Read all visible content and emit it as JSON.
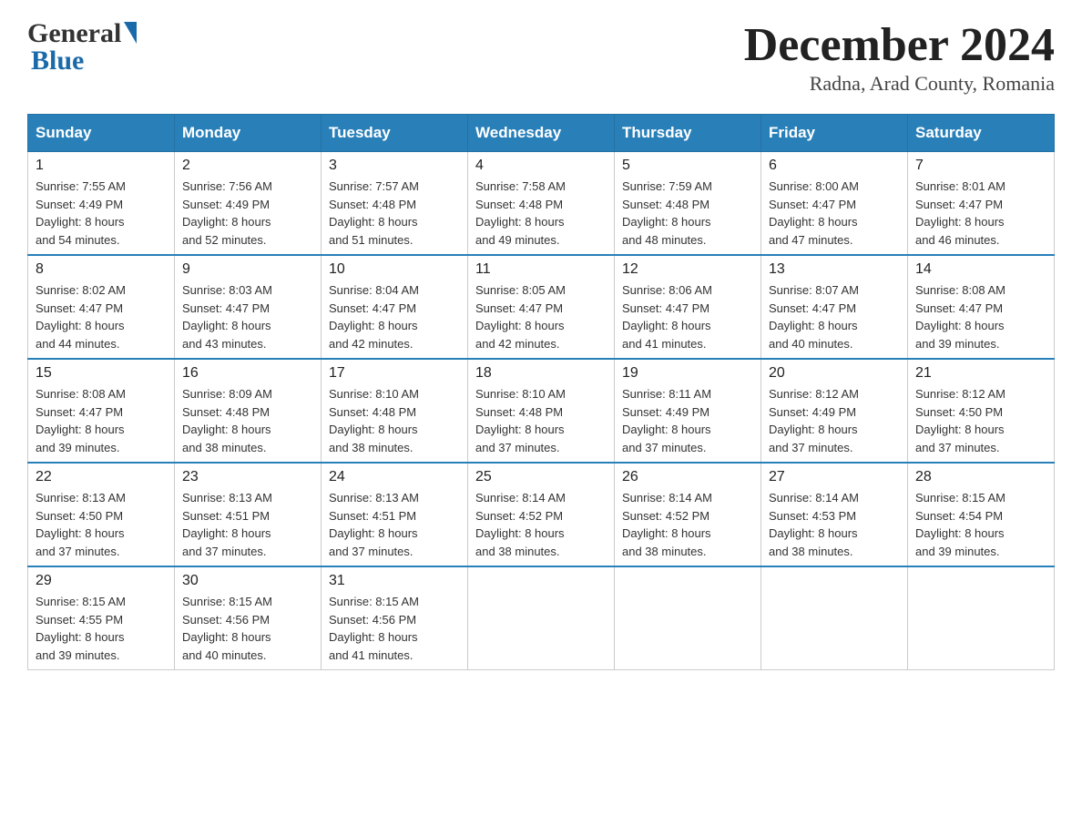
{
  "header": {
    "logo_general": "General",
    "logo_blue": "Blue",
    "month_title": "December 2024",
    "location": "Radna, Arad County, Romania"
  },
  "weekdays": [
    "Sunday",
    "Monday",
    "Tuesday",
    "Wednesday",
    "Thursday",
    "Friday",
    "Saturday"
  ],
  "weeks": [
    [
      {
        "day": "1",
        "sunrise": "Sunrise: 7:55 AM",
        "sunset": "Sunset: 4:49 PM",
        "daylight": "Daylight: 8 hours",
        "daylight2": "and 54 minutes."
      },
      {
        "day": "2",
        "sunrise": "Sunrise: 7:56 AM",
        "sunset": "Sunset: 4:49 PM",
        "daylight": "Daylight: 8 hours",
        "daylight2": "and 52 minutes."
      },
      {
        "day": "3",
        "sunrise": "Sunrise: 7:57 AM",
        "sunset": "Sunset: 4:48 PM",
        "daylight": "Daylight: 8 hours",
        "daylight2": "and 51 minutes."
      },
      {
        "day": "4",
        "sunrise": "Sunrise: 7:58 AM",
        "sunset": "Sunset: 4:48 PM",
        "daylight": "Daylight: 8 hours",
        "daylight2": "and 49 minutes."
      },
      {
        "day": "5",
        "sunrise": "Sunrise: 7:59 AM",
        "sunset": "Sunset: 4:48 PM",
        "daylight": "Daylight: 8 hours",
        "daylight2": "and 48 minutes."
      },
      {
        "day": "6",
        "sunrise": "Sunrise: 8:00 AM",
        "sunset": "Sunset: 4:47 PM",
        "daylight": "Daylight: 8 hours",
        "daylight2": "and 47 minutes."
      },
      {
        "day": "7",
        "sunrise": "Sunrise: 8:01 AM",
        "sunset": "Sunset: 4:47 PM",
        "daylight": "Daylight: 8 hours",
        "daylight2": "and 46 minutes."
      }
    ],
    [
      {
        "day": "8",
        "sunrise": "Sunrise: 8:02 AM",
        "sunset": "Sunset: 4:47 PM",
        "daylight": "Daylight: 8 hours",
        "daylight2": "and 44 minutes."
      },
      {
        "day": "9",
        "sunrise": "Sunrise: 8:03 AM",
        "sunset": "Sunset: 4:47 PM",
        "daylight": "Daylight: 8 hours",
        "daylight2": "and 43 minutes."
      },
      {
        "day": "10",
        "sunrise": "Sunrise: 8:04 AM",
        "sunset": "Sunset: 4:47 PM",
        "daylight": "Daylight: 8 hours",
        "daylight2": "and 42 minutes."
      },
      {
        "day": "11",
        "sunrise": "Sunrise: 8:05 AM",
        "sunset": "Sunset: 4:47 PM",
        "daylight": "Daylight: 8 hours",
        "daylight2": "and 42 minutes."
      },
      {
        "day": "12",
        "sunrise": "Sunrise: 8:06 AM",
        "sunset": "Sunset: 4:47 PM",
        "daylight": "Daylight: 8 hours",
        "daylight2": "and 41 minutes."
      },
      {
        "day": "13",
        "sunrise": "Sunrise: 8:07 AM",
        "sunset": "Sunset: 4:47 PM",
        "daylight": "Daylight: 8 hours",
        "daylight2": "and 40 minutes."
      },
      {
        "day": "14",
        "sunrise": "Sunrise: 8:08 AM",
        "sunset": "Sunset: 4:47 PM",
        "daylight": "Daylight: 8 hours",
        "daylight2": "and 39 minutes."
      }
    ],
    [
      {
        "day": "15",
        "sunrise": "Sunrise: 8:08 AM",
        "sunset": "Sunset: 4:47 PM",
        "daylight": "Daylight: 8 hours",
        "daylight2": "and 39 minutes."
      },
      {
        "day": "16",
        "sunrise": "Sunrise: 8:09 AM",
        "sunset": "Sunset: 4:48 PM",
        "daylight": "Daylight: 8 hours",
        "daylight2": "and 38 minutes."
      },
      {
        "day": "17",
        "sunrise": "Sunrise: 8:10 AM",
        "sunset": "Sunset: 4:48 PM",
        "daylight": "Daylight: 8 hours",
        "daylight2": "and 38 minutes."
      },
      {
        "day": "18",
        "sunrise": "Sunrise: 8:10 AM",
        "sunset": "Sunset: 4:48 PM",
        "daylight": "Daylight: 8 hours",
        "daylight2": "and 37 minutes."
      },
      {
        "day": "19",
        "sunrise": "Sunrise: 8:11 AM",
        "sunset": "Sunset: 4:49 PM",
        "daylight": "Daylight: 8 hours",
        "daylight2": "and 37 minutes."
      },
      {
        "day": "20",
        "sunrise": "Sunrise: 8:12 AM",
        "sunset": "Sunset: 4:49 PM",
        "daylight": "Daylight: 8 hours",
        "daylight2": "and 37 minutes."
      },
      {
        "day": "21",
        "sunrise": "Sunrise: 8:12 AM",
        "sunset": "Sunset: 4:50 PM",
        "daylight": "Daylight: 8 hours",
        "daylight2": "and 37 minutes."
      }
    ],
    [
      {
        "day": "22",
        "sunrise": "Sunrise: 8:13 AM",
        "sunset": "Sunset: 4:50 PM",
        "daylight": "Daylight: 8 hours",
        "daylight2": "and 37 minutes."
      },
      {
        "day": "23",
        "sunrise": "Sunrise: 8:13 AM",
        "sunset": "Sunset: 4:51 PM",
        "daylight": "Daylight: 8 hours",
        "daylight2": "and 37 minutes."
      },
      {
        "day": "24",
        "sunrise": "Sunrise: 8:13 AM",
        "sunset": "Sunset: 4:51 PM",
        "daylight": "Daylight: 8 hours",
        "daylight2": "and 37 minutes."
      },
      {
        "day": "25",
        "sunrise": "Sunrise: 8:14 AM",
        "sunset": "Sunset: 4:52 PM",
        "daylight": "Daylight: 8 hours",
        "daylight2": "and 38 minutes."
      },
      {
        "day": "26",
        "sunrise": "Sunrise: 8:14 AM",
        "sunset": "Sunset: 4:52 PM",
        "daylight": "Daylight: 8 hours",
        "daylight2": "and 38 minutes."
      },
      {
        "day": "27",
        "sunrise": "Sunrise: 8:14 AM",
        "sunset": "Sunset: 4:53 PM",
        "daylight": "Daylight: 8 hours",
        "daylight2": "and 38 minutes."
      },
      {
        "day": "28",
        "sunrise": "Sunrise: 8:15 AM",
        "sunset": "Sunset: 4:54 PM",
        "daylight": "Daylight: 8 hours",
        "daylight2": "and 39 minutes."
      }
    ],
    [
      {
        "day": "29",
        "sunrise": "Sunrise: 8:15 AM",
        "sunset": "Sunset: 4:55 PM",
        "daylight": "Daylight: 8 hours",
        "daylight2": "and 39 minutes."
      },
      {
        "day": "30",
        "sunrise": "Sunrise: 8:15 AM",
        "sunset": "Sunset: 4:56 PM",
        "daylight": "Daylight: 8 hours",
        "daylight2": "and 40 minutes."
      },
      {
        "day": "31",
        "sunrise": "Sunrise: 8:15 AM",
        "sunset": "Sunset: 4:56 PM",
        "daylight": "Daylight: 8 hours",
        "daylight2": "and 41 minutes."
      },
      null,
      null,
      null,
      null
    ]
  ]
}
